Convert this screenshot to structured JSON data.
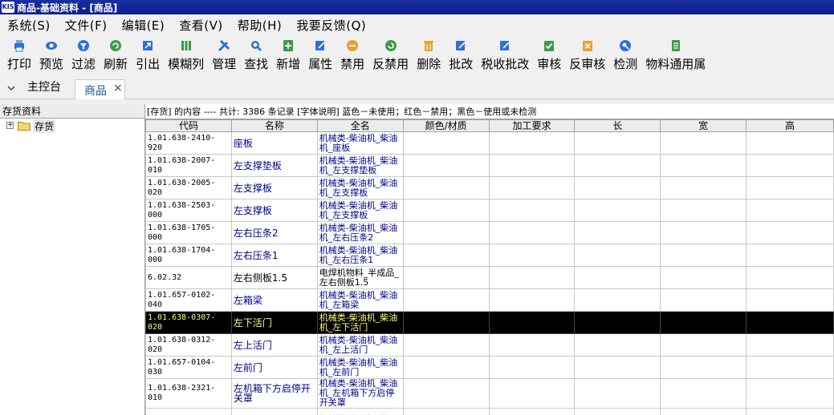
{
  "window": {
    "title": "商品-基础资料 - [商品]",
    "logo_text": "KIS"
  },
  "menu": [
    "系统(S)",
    "文件(F)",
    "编辑(E)",
    "查看(V)",
    "帮助(H)",
    "我要反馈(Q)"
  ],
  "toolbar": [
    {
      "label": "打印",
      "icon": "printer-icon",
      "color": "#2e6fd4"
    },
    {
      "label": "预览",
      "icon": "eye-icon",
      "color": "#2e6fd4"
    },
    {
      "label": "过滤",
      "icon": "filter-icon",
      "color": "#2e6fd4"
    },
    {
      "label": "刷新",
      "icon": "refresh-icon",
      "color": "#3c9a4a"
    },
    {
      "label": "引出",
      "icon": "export-icon",
      "color": "#2e6fd4"
    },
    {
      "label": "模糊列",
      "icon": "columns-icon",
      "color": "#3c9a4a"
    },
    {
      "label": "管理",
      "icon": "tools-icon",
      "color": "#2e6fd4"
    },
    {
      "label": "查找",
      "icon": "search-icon",
      "color": "#2e6fd4"
    },
    {
      "label": "新增",
      "icon": "add-icon",
      "color": "#3c9a4a"
    },
    {
      "label": "属性",
      "icon": "edit-icon",
      "color": "#2e6fd4"
    },
    {
      "label": "禁用",
      "icon": "disable-icon",
      "color": "#e8a030"
    },
    {
      "label": "反禁用",
      "icon": "enable-icon",
      "color": "#3c9a4a"
    },
    {
      "label": "删除",
      "icon": "trash-icon",
      "color": "#e8a030"
    },
    {
      "label": "批改",
      "icon": "batch-edit-icon",
      "color": "#2e6fd4"
    },
    {
      "label": "税收批改",
      "icon": "tax-edit-icon",
      "color": "#2e6fd4"
    },
    {
      "label": "审核",
      "icon": "approve-icon",
      "color": "#3c9a4a"
    },
    {
      "label": "反审核",
      "icon": "unapprove-icon",
      "color": "#e8a030"
    },
    {
      "label": "检测",
      "icon": "inspect-icon",
      "color": "#2e6fd4"
    },
    {
      "label": "物料通用属",
      "icon": "material-icon",
      "color": "#3c9a4a"
    }
  ],
  "tabs": {
    "home": "主控台",
    "active": "商品",
    "close": "×"
  },
  "tree": {
    "header": "存货资料",
    "root_label": "存货",
    "expander": "+"
  },
  "info_bar": "[存货] 的内容 ---- 共计: 3386 条记录  [字体说明] 蓝色－未使用；红色－禁用；黑色－使用或未检测",
  "columns": [
    "代码",
    "名称",
    "全名",
    "颜色/材质",
    "加工要求",
    "长",
    "宽",
    "高"
  ],
  "rows": [
    {
      "code": "1.01.638-2410-920",
      "name": "座板",
      "fullname": "机械类-柴油机_柴油机_座板",
      "state": "unused"
    },
    {
      "code": "1.01.638-2007-010",
      "name": "左支撑垫板",
      "fullname": "机械类-柴油机_柴油机_左支撑垫板",
      "state": "unused"
    },
    {
      "code": "1.01.638-2005-020",
      "name": "左支撑板",
      "fullname": "机械类-柴油机_柴油机_左支撑板",
      "state": "unused"
    },
    {
      "code": "1.01.638-2503-000",
      "name": "左支撑板",
      "fullname": "机械类-柴油机_柴油机_左支撑板",
      "state": "unused"
    },
    {
      "code": "1.01.638-1705-000",
      "name": "左右压条2",
      "fullname": "机械类-柴油机_柴油机_左右压条2",
      "state": "unused"
    },
    {
      "code": "1.01.638-1704-000",
      "name": "左右压条1",
      "fullname": "机械类-柴油机_柴油机_左右压条1",
      "state": "unused"
    },
    {
      "code": "6.02.32",
      "name": "左右侧板1.5",
      "fullname": "电焊机物料_半成品_左右侧板1.5",
      "state": "normal"
    },
    {
      "code": "1.01.657-0102-040",
      "name": "左箱梁",
      "fullname": "机械类-柴油机_柴油机_左箱梁",
      "state": "unused"
    },
    {
      "code": "1.01.638-0307-020",
      "name": "左下活门",
      "fullname": "机械类-柴油机_柴油机_左下活门",
      "state": "selected"
    },
    {
      "code": "1.01.638-0312-020",
      "name": "左上活门",
      "fullname": "机械类-柴油机_柴油机_左上活门",
      "state": "unused"
    },
    {
      "code": "1.01.657-0104-030",
      "name": "左前门",
      "fullname": "机械类-柴油机_柴油机_左前门",
      "state": "unused"
    },
    {
      "code": "1.01.638-2321-010",
      "name": "左机箱下方启停开关罩",
      "fullname": "机械类-柴油机_柴油机_左机箱下方启停开关罩",
      "state": "unused"
    },
    {
      "code": "",
      "name": "",
      "fullname": "机械类-柴油机_柴",
      "state": "unused"
    }
  ]
}
